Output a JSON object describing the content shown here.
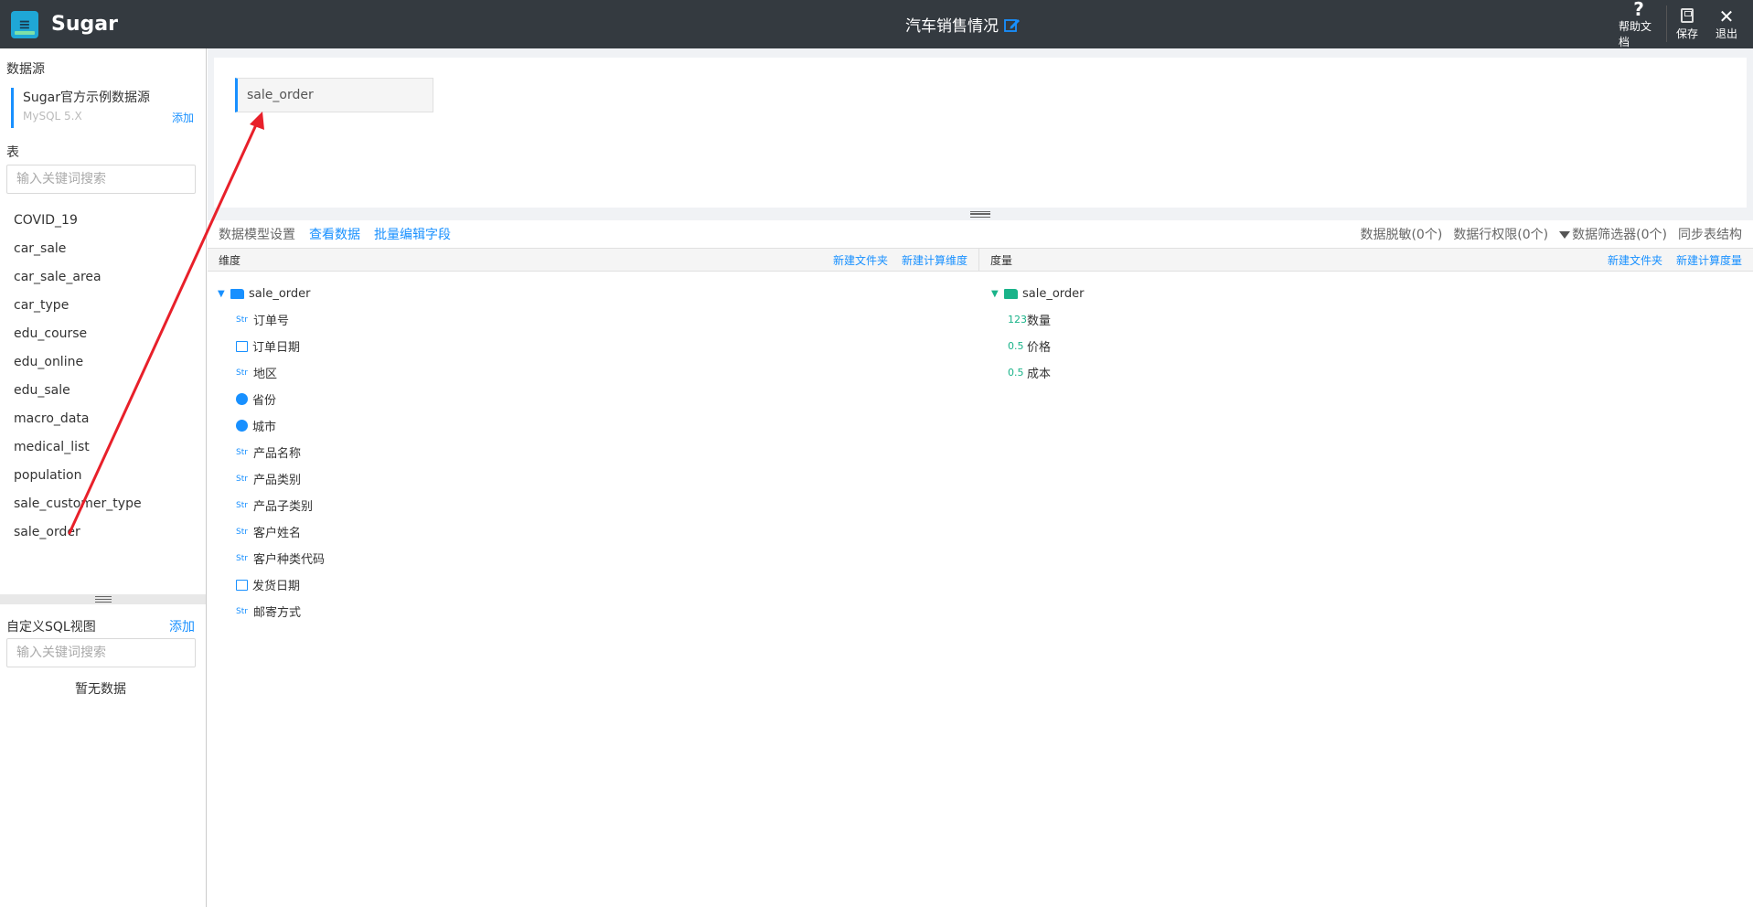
{
  "app": {
    "brand": "Sugar",
    "doc_title": "汽车销售情况"
  },
  "top_actions": [
    {
      "label": "帮助文档",
      "icon": "help-icon"
    },
    {
      "label": "保存",
      "icon": "save-icon"
    },
    {
      "label": "退出",
      "icon": "close-icon"
    }
  ],
  "sidebar": {
    "datasource_title": "数据源",
    "datasource": {
      "name": "Sugar官方示例数据源",
      "type": "MySQL 5.X",
      "add": "添加"
    },
    "tables_title": "表",
    "table_search_placeholder": "输入关键词搜索",
    "tables": [
      "COVID_19",
      "car_sale",
      "car_sale_area",
      "car_type",
      "edu_course",
      "edu_online",
      "edu_sale",
      "macro_data",
      "medical_list",
      "population",
      "sale_customer_type",
      "sale_order"
    ],
    "sql_title": "自定义SQL视图",
    "sql_add": "添加",
    "sql_search_placeholder": "输入关键词搜索",
    "empty": "暂无数据"
  },
  "canvas": {
    "table_chip": "sale_order"
  },
  "toolbar": {
    "model_settings": "数据模型设置",
    "view_data": "查看数据",
    "batch_edit": "批量编辑字段",
    "mask": "数据脱敏(0个)",
    "row_perm": "数据行权限(0个)",
    "filter": "数据筛选器(0个)",
    "sync": "同步表结构"
  },
  "dimensions": {
    "title": "维度",
    "new_folder": "新建文件夹",
    "new_calc": "新建计算维度",
    "folder": "sale_order",
    "fields": [
      {
        "type": "str",
        "type_label": "Str",
        "name": "订单号"
      },
      {
        "type": "date",
        "type_label": "",
        "name": "订单日期"
      },
      {
        "type": "str",
        "type_label": "Str",
        "name": "地区"
      },
      {
        "type": "geo",
        "type_label": "",
        "name": "省份"
      },
      {
        "type": "geo",
        "type_label": "",
        "name": "城市"
      },
      {
        "type": "str",
        "type_label": "Str",
        "name": "产品名称"
      },
      {
        "type": "str",
        "type_label": "Str",
        "name": "产品类别"
      },
      {
        "type": "str",
        "type_label": "Str",
        "name": "产品子类别"
      },
      {
        "type": "str",
        "type_label": "Str",
        "name": "客户姓名"
      },
      {
        "type": "str",
        "type_label": "Str",
        "name": "客户种类代码"
      },
      {
        "type": "date",
        "type_label": "",
        "name": "发货日期"
      },
      {
        "type": "str",
        "type_label": "Str",
        "name": "邮寄方式"
      }
    ]
  },
  "measures": {
    "title": "度量",
    "new_folder": "新建文件夹",
    "new_calc": "新建计算度量",
    "folder": "sale_order",
    "fields": [
      {
        "type": "int",
        "type_label": "123",
        "name": "数量"
      },
      {
        "type": "float",
        "type_label": "0.5",
        "name": "价格"
      },
      {
        "type": "float",
        "type_label": "0.5",
        "name": "成本"
      }
    ]
  },
  "colors": {
    "accent": "#1890ff",
    "topbar": "#343a40",
    "measure": "#19b389",
    "arrow": "#e8202a"
  }
}
